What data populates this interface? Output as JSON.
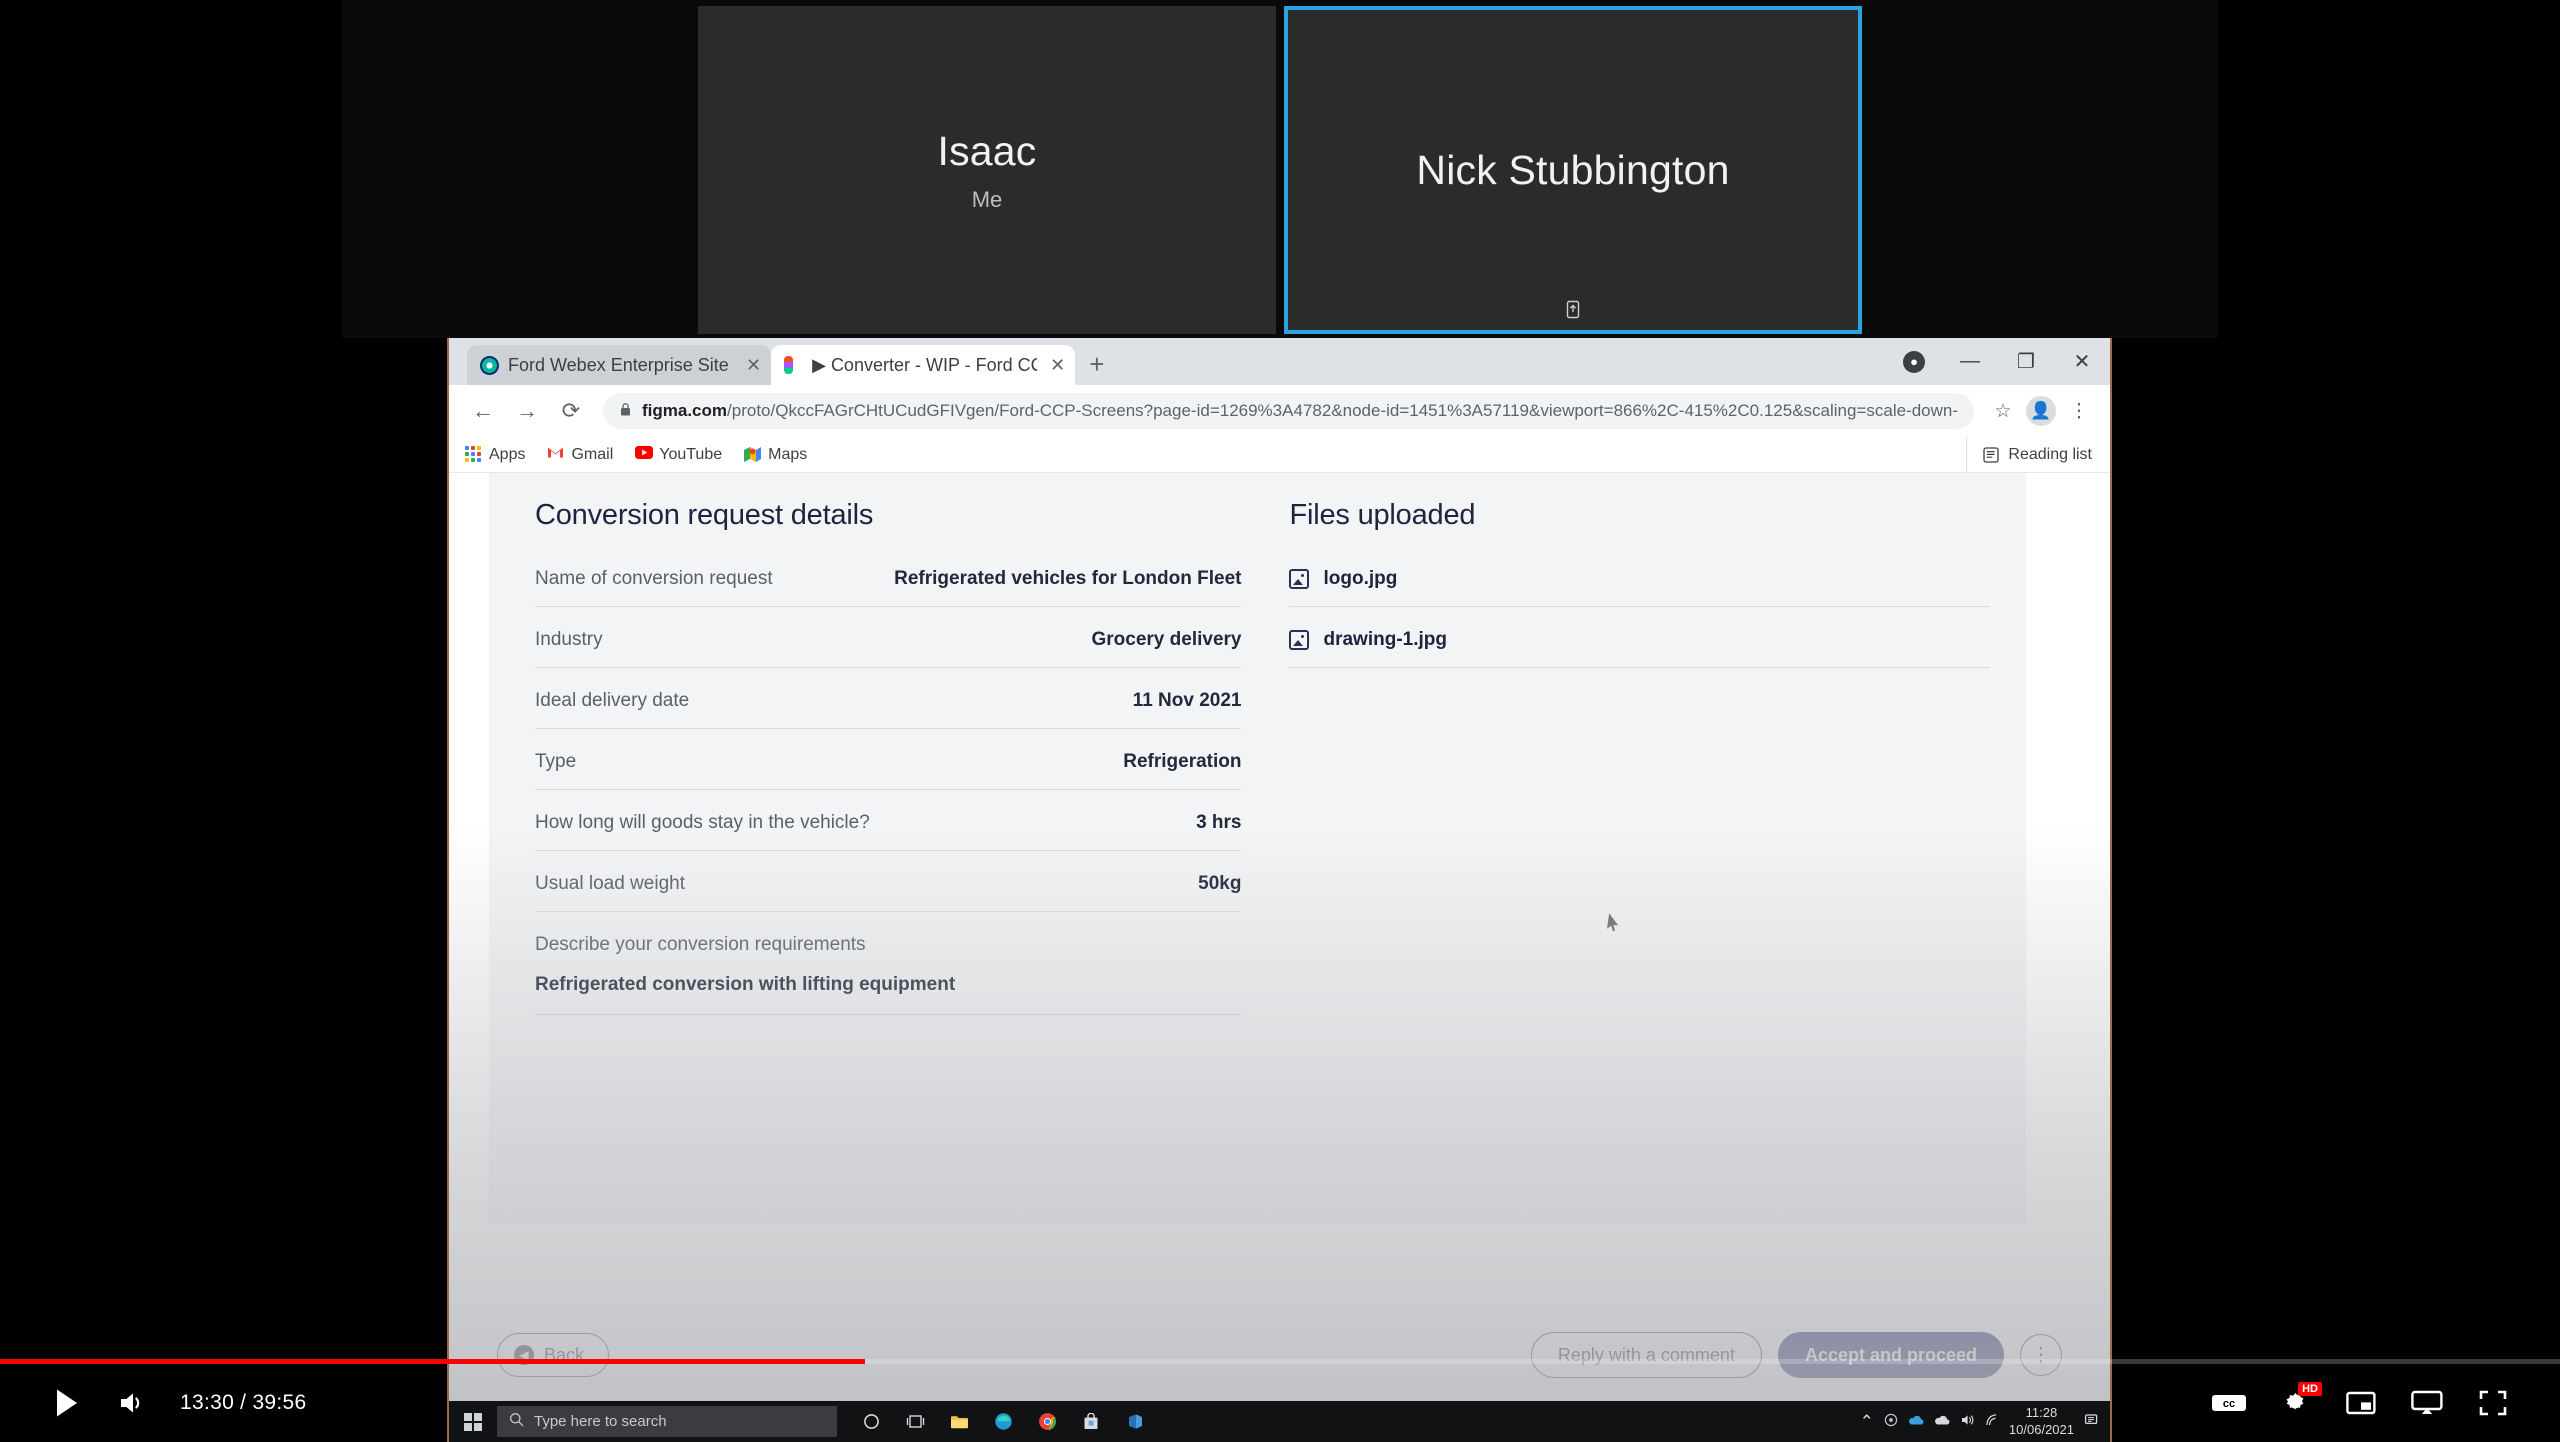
{
  "video_call": {
    "participants": [
      {
        "name": "Isaac",
        "subtitle": "Me",
        "active": false,
        "share_icon": ""
      },
      {
        "name": "Nick Stubbington",
        "subtitle": "",
        "active": true,
        "share_icon": "screen-share-icon"
      }
    ],
    "active_border_color": "#2aa3e0"
  },
  "browser": {
    "tabs": [
      {
        "title": "Ford Webex Enterprise Site - Me",
        "favicon": "webex-icon",
        "active": false,
        "close_label": "✕"
      },
      {
        "title": "▶ Converter - WIP - Ford CCP S",
        "favicon": "figma-icon",
        "active": true,
        "close_label": "✕"
      }
    ],
    "new_tab_label": "+",
    "window_controls": {
      "update_label": "●",
      "minimize_label": "—",
      "maximize_label": "❐",
      "close_label": "✕"
    },
    "nav": {
      "back": "←",
      "forward": "→",
      "reload": "⟳"
    },
    "omnibox": {
      "lock_icon": "lock-icon",
      "url_domain": "figma.com",
      "url_path": "/proto/QkccFAGrCHtUCudGFIVgen/Ford-CCP-Screens?page-id=1269%3A4782&node-id=1451%3A57119&viewport=866%2C-415%2C0.125&scaling=scale-down-widt...",
      "star_icon": "☆",
      "profile_icon": "👤",
      "menu_icon": "⋮"
    },
    "bookmarks": [
      {
        "label": "Apps",
        "icon": "apps-grid-icon"
      },
      {
        "label": "Gmail",
        "icon": "gmail-icon"
      },
      {
        "label": "YouTube",
        "icon": "youtube-icon"
      },
      {
        "label": "Maps",
        "icon": "maps-icon"
      }
    ],
    "reading_list": {
      "label": "Reading list",
      "icon": "reading-list-icon"
    }
  },
  "prototype": {
    "details": {
      "title": "Conversion request details",
      "rows": [
        {
          "label": "Name of conversion request",
          "value": "Refrigerated vehicles for London Fleet"
        },
        {
          "label": "Industry",
          "value": "Grocery delivery"
        },
        {
          "label": "Ideal delivery date",
          "value": "11 Nov 2021"
        },
        {
          "label": "Type",
          "value": "Refrigeration"
        },
        {
          "label": "How long will goods stay in the vehicle?",
          "value": "3 hrs"
        },
        {
          "label": "Usual load weight",
          "value": "50kg"
        }
      ],
      "description": {
        "label": "Describe your conversion requirements",
        "value": "Refrigerated conversion with lifting equipment"
      }
    },
    "files": {
      "title": "Files uploaded",
      "items": [
        {
          "name": "logo.jpg",
          "icon": "image-file-icon"
        },
        {
          "name": "drawing-1.jpg",
          "icon": "image-file-icon"
        }
      ]
    },
    "actions": {
      "back": "Back",
      "back_icon": "◀",
      "reply": "Reply with a comment",
      "accept": "Accept and proceed",
      "more_icon": "⋮",
      "accept_color": "#171c63"
    }
  },
  "taskbar": {
    "search_placeholder": "Type here to search",
    "search_icon": "search-icon",
    "start_icon": "windows-start-icon",
    "pinned": [
      {
        "icon": "cortana-icon"
      },
      {
        "icon": "task-view-icon"
      },
      {
        "icon": "file-explorer-icon"
      },
      {
        "icon": "edge-icon"
      },
      {
        "icon": "chrome-icon"
      },
      {
        "icon": "store-icon"
      },
      {
        "icon": "office-icon"
      }
    ],
    "tray": {
      "chevron": "⌃",
      "time": "11:28",
      "date": "10/06/2021",
      "notifications_icon": "notification-icon"
    }
  },
  "youtube": {
    "play_icon": "play-icon",
    "volume_icon": "volume-icon",
    "time": "13:30 / 39:56",
    "current_time": "13:30",
    "duration": "39:56",
    "progress_percent": 33.8,
    "progress_color": "#ff0000",
    "controls": [
      {
        "icon": "subtitles-cc-icon",
        "label": "CC"
      },
      {
        "icon": "settings-gear-icon",
        "badge": "HD"
      },
      {
        "icon": "miniplayer-icon"
      },
      {
        "icon": "cast-tv-icon"
      },
      {
        "icon": "fullscreen-icon"
      }
    ]
  }
}
